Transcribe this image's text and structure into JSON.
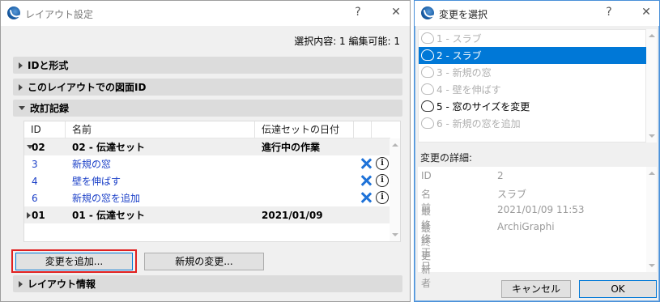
{
  "left_dialog": {
    "title": "レイアウト設定",
    "help": "?",
    "close": "✕",
    "selection_info": "選択内容: 1 編集可能: 1",
    "sections": {
      "id_format": "IDと形式",
      "drawing_id": "このレイアウトでの図面ID",
      "revision": "改訂記録",
      "layout_info": "レイアウト情報"
    },
    "table": {
      "headers": [
        "ID",
        "名前",
        "伝達セットの日付"
      ],
      "rows": [
        {
          "id": "02",
          "name": "02 - 伝達セット",
          "date": "進行中の作業"
        },
        {
          "id": "3",
          "name": "新規の窓"
        },
        {
          "id": "4",
          "name": "壁を伸ばす"
        },
        {
          "id": "6",
          "name": "新規の窓を追加"
        },
        {
          "id": "01",
          "name": "01 - 伝達セット",
          "date": "2021/01/09"
        }
      ]
    },
    "buttons": {
      "add_change": "変更を追加...",
      "new_change": "新規の変更..."
    }
  },
  "right_dialog": {
    "title": "変更を選択",
    "help": "?",
    "close": "✕",
    "changes": [
      {
        "label": "1 - スラブ",
        "state": "disabled"
      },
      {
        "label": "2 - スラブ",
        "state": "selected"
      },
      {
        "label": "3 - 新規の窓",
        "state": "disabled"
      },
      {
        "label": "4 - 壁を伸ばす",
        "state": "disabled"
      },
      {
        "label": "5 - 窓のサイズを変更",
        "state": "active"
      },
      {
        "label": "6 - 新規の窓を追加",
        "state": "disabled"
      }
    ],
    "details_heading": "変更の詳細:",
    "details": [
      {
        "key": "ID",
        "value": "2"
      },
      {
        "key": "名前",
        "value": "スラブ"
      },
      {
        "key": "最終修正日",
        "value": "2021/01/09 11:53"
      },
      {
        "key": "最終更新者",
        "value": "ArchiGraphi"
      }
    ],
    "buttons": {
      "cancel": "キャンセル",
      "ok": "OK"
    }
  },
  "colors": {
    "accent": "#0078d7",
    "link_blue": "#1a3fc7",
    "delete_x": "#1e72d8",
    "highlight_frame": "#e02020"
  }
}
